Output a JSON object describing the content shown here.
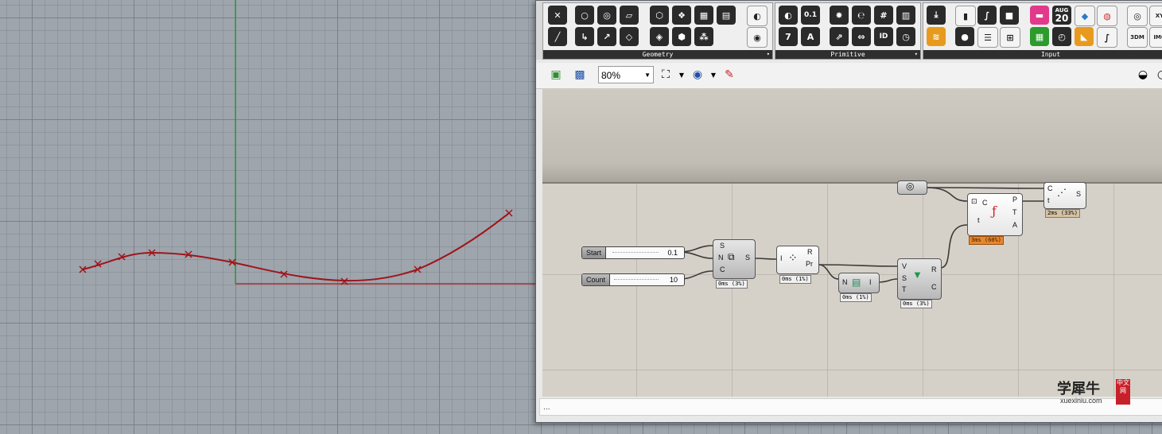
{
  "ribbon": {
    "panels": [
      "Geometry",
      "Primitive",
      "Input"
    ],
    "input_date": {
      "month": "AUG",
      "day": "20"
    },
    "primitive_icons": [
      "0.1",
      "7",
      "A",
      "ID"
    ],
    "input_icons": [
      "3DM",
      "IMG",
      "XY"
    ]
  },
  "toolbar": {
    "zoom": "80%"
  },
  "components": {
    "slider_start": {
      "label": "Start",
      "value": "0.1"
    },
    "slider_count": {
      "label": "Count",
      "value": "10"
    },
    "series": {
      "inputs": [
        "S",
        "N",
        "C"
      ],
      "outputs": [
        "S"
      ],
      "timing": "0ms (3%)"
    },
    "random": {
      "inputs": [
        "I"
      ],
      "outputs": [
        "R",
        "Pr"
      ],
      "timing": "0ms (1%)"
    },
    "list_item": {
      "inputs": [
        "N"
      ],
      "outputs": [
        "I"
      ],
      "timing": "0ms (1%)"
    },
    "construct_point": {
      "inputs": [
        "V",
        "S",
        "T"
      ],
      "outputs": [
        "R",
        "C"
      ],
      "timing": "0ms (3%)"
    },
    "curve_param": {
      "inputs": [
        "C",
        "t"
      ],
      "outputs": [
        "P",
        "T",
        "A"
      ],
      "timing": "3ms (60%)"
    },
    "divide": {
      "inputs": [
        "C",
        "t"
      ],
      "outputs": [
        "S"
      ],
      "timing": "2ms (33%)"
    }
  },
  "status": {
    "text": "..."
  },
  "watermark": {
    "cn": "学犀牛",
    "en": "xuexiniu.com",
    "badge": "中文网"
  },
  "colors": {
    "curve": "#a0141a",
    "x_axis": "#b01818",
    "y_axis": "#1c9a1c",
    "timing_hot": "#e8862a"
  }
}
